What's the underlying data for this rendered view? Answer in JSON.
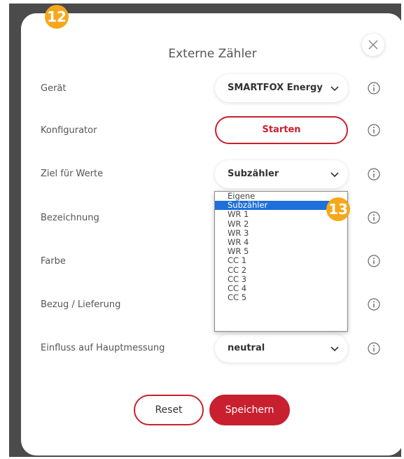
{
  "badges": {
    "step_a": "12",
    "step_b": "13"
  },
  "dialog": {
    "title": "Externe Zähler"
  },
  "rows": {
    "geraet": {
      "label": "Gerät",
      "value": "SMARTFOX Energy M"
    },
    "konfigurator": {
      "label": "Konfigurator",
      "button": "Starten"
    },
    "ziel": {
      "label": "Ziel für Werte",
      "value": "Subzähler"
    },
    "bezeichnung": {
      "label": "Bezeichnung"
    },
    "farbe": {
      "label": "Farbe"
    },
    "bezug": {
      "label": "Bezug / Lieferung"
    },
    "einfluss": {
      "label": "Einfluss auf Hauptmessung",
      "value": "neutral"
    }
  },
  "dropdown": {
    "options": [
      "Eigene",
      "Subzähler",
      "WR 1",
      "WR 2",
      "WR 3",
      "WR 4",
      "WR 5",
      "CC 1",
      "CC 2",
      "CC 3",
      "CC 4",
      "CC 5"
    ],
    "selected_index": 1
  },
  "buttons": {
    "reset": "Reset",
    "save": "Speichern"
  },
  "colors": {
    "accent": "#c8202f",
    "badge": "#f5a81c",
    "selection": "#1e6fd9"
  },
  "icons": {
    "close": "close-icon",
    "info": "info-icon",
    "chevron": "chevron-down-icon"
  }
}
